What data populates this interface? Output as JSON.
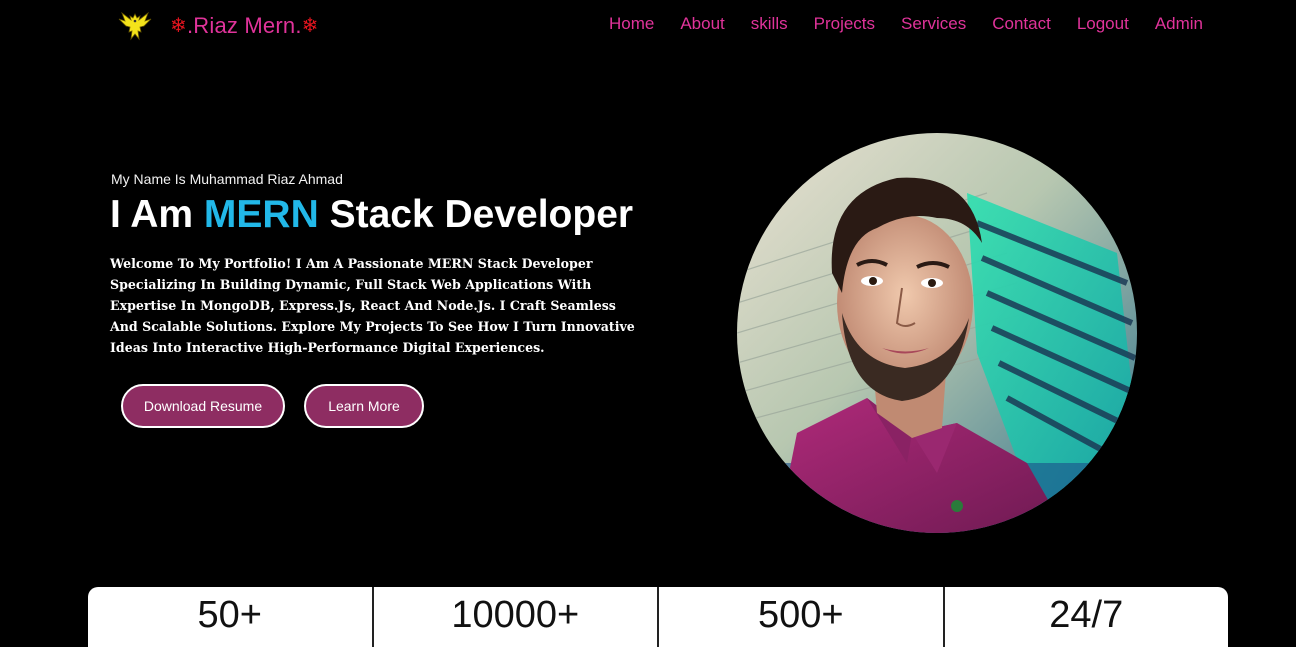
{
  "brand": {
    "name": ".Riaz Mern.",
    "logo_icon": "eagle-logo-icon",
    "snowflake_icon": "snowflake-icon",
    "accent": "#e0339a"
  },
  "nav": {
    "items": [
      {
        "label": "Home"
      },
      {
        "label": "About"
      },
      {
        "label": "skills"
      },
      {
        "label": "Projects"
      },
      {
        "label": "Services"
      },
      {
        "label": "Contact"
      },
      {
        "label": "Logout"
      },
      {
        "label": "Admin"
      }
    ]
  },
  "hero": {
    "intro": "My Name Is Muhammad Riaz Ahmad",
    "heading_prefix": "I Am ",
    "heading_accent": "MERN",
    "heading_suffix": " Stack Developer",
    "accent_color": "#22b8e8",
    "description": "Welcome To My Portfolio! I Am A Passionate MERN Stack Developer Specializing In Building Dynamic, Full Stack Web Applications With Expertise In MongoDB, Express.Js, React And Node.Js. I Craft Seamless And Scalable Solutions. Explore My Projects To See How I Turn Innovative Ideas Into Interactive High-Performance Digital Experiences.",
    "buttons": {
      "resume": "Download Resume",
      "learn": "Learn More"
    },
    "button_color": "#8e2d62"
  },
  "stats": [
    {
      "value": "50+"
    },
    {
      "value": "10000+"
    },
    {
      "value": "500+"
    },
    {
      "value": "24/7"
    }
  ]
}
